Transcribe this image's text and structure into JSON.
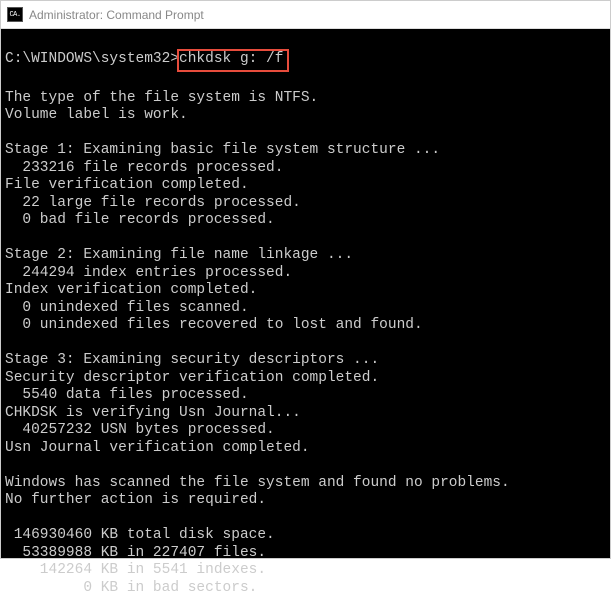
{
  "titlebar": {
    "icon_text": "CA.",
    "title": "Administrator: Command Prompt"
  },
  "prompt": {
    "path": "C:\\WINDOWS\\system32>",
    "command": "chkdsk g: /f"
  },
  "output": {
    "l01": "The type of the file system is NTFS.",
    "l02": "Volume label is work.",
    "l03": "",
    "l04": "Stage 1: Examining basic file system structure ...",
    "l05": "  233216 file records processed.",
    "l06": "File verification completed.",
    "l07": "  22 large file records processed.",
    "l08": "  0 bad file records processed.",
    "l09": "",
    "l10": "Stage 2: Examining file name linkage ...",
    "l11": "  244294 index entries processed.",
    "l12": "Index verification completed.",
    "l13": "  0 unindexed files scanned.",
    "l14": "  0 unindexed files recovered to lost and found.",
    "l15": "",
    "l16": "Stage 3: Examining security descriptors ...",
    "l17": "Security descriptor verification completed.",
    "l18": "  5540 data files processed.",
    "l19": "CHKDSK is verifying Usn Journal...",
    "l20": "  40257232 USN bytes processed.",
    "l21": "Usn Journal verification completed.",
    "l22": "",
    "l23": "Windows has scanned the file system and found no problems.",
    "l24": "No further action is required.",
    "l25": "",
    "l26": " 146930460 KB total disk space.",
    "l27": "  53389988 KB in 227407 files.",
    "l28": "    142264 KB in 5541 indexes.",
    "l29": "         0 KB in bad sectors."
  }
}
